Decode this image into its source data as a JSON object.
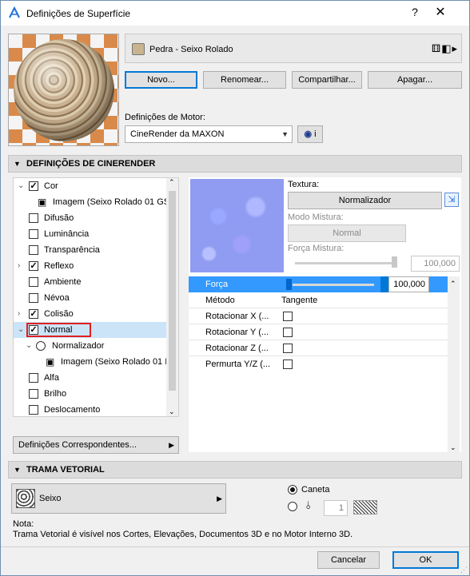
{
  "window": {
    "title": "Definições de Superfície",
    "help": "?",
    "close": "✕"
  },
  "material": {
    "name": "Pedra - Seixo Rolado",
    "swatch_color": "#c8b58f",
    "icons": "⚅◧▸"
  },
  "buttons": {
    "new": "Novo...",
    "rename": "Renomear...",
    "share": "Compartilhar...",
    "delete": "Apagar..."
  },
  "engine": {
    "label": "Definições de Motor:",
    "value": "CineRender da MAXON",
    "info": "i"
  },
  "cinerender": {
    "header": "DEFINIÇÕES DE CINERENDER",
    "tree": [
      {
        "label": "Cor",
        "checked": true
      },
      {
        "label": "Imagem (Seixo Rolado 01 GS"
      },
      {
        "label": "Difusão",
        "checked": false
      },
      {
        "label": "Luminância",
        "checked": false
      },
      {
        "label": "Transparência",
        "checked": false
      },
      {
        "label": "Reflexo",
        "checked": true
      },
      {
        "label": "Ambiente",
        "checked": false
      },
      {
        "label": "Névoa",
        "checked": false
      },
      {
        "label": "Colisão",
        "checked": true
      },
      {
        "label": "Normal",
        "checked": true
      },
      {
        "label": "Normalizador"
      },
      {
        "label": "Imagem (Seixo Rolado 01 I"
      },
      {
        "label": "Alfa",
        "checked": false
      },
      {
        "label": "Brilho",
        "checked": false
      },
      {
        "label": "Deslocamento",
        "checked": false
      }
    ],
    "matching_settings": "Definições Correspondentes...",
    "texture_label": "Textura:",
    "texture_value": "Normalizador",
    "blend_mode_label": "Modo Mistura:",
    "blend_mode_value": "Normal",
    "blend_strength_label": "Força Mistura:",
    "blend_strength_value": "100,000",
    "props": {
      "strength_label": "Força",
      "strength_value": "100,000",
      "method_label": "Método",
      "method_value": "Tangente",
      "rot_x": "Rotacionar X (...",
      "rot_y": "Rotacionar Y (...",
      "rot_z": "Rotacionar Z (...",
      "swap_yz": "Permurta Y/Z (..."
    }
  },
  "vector_hatch": {
    "header": "TRAMA VETORIAL",
    "pattern": "Seixo",
    "pen_label": "Caneta",
    "pen_number": "1"
  },
  "note": {
    "title": "Nota:",
    "text": "Trama Vetorial é visível nos Cortes, Elevações, Documentos 3D e  no Motor Interno 3D."
  },
  "footer": {
    "cancel": "Cancelar",
    "ok": "OK"
  }
}
